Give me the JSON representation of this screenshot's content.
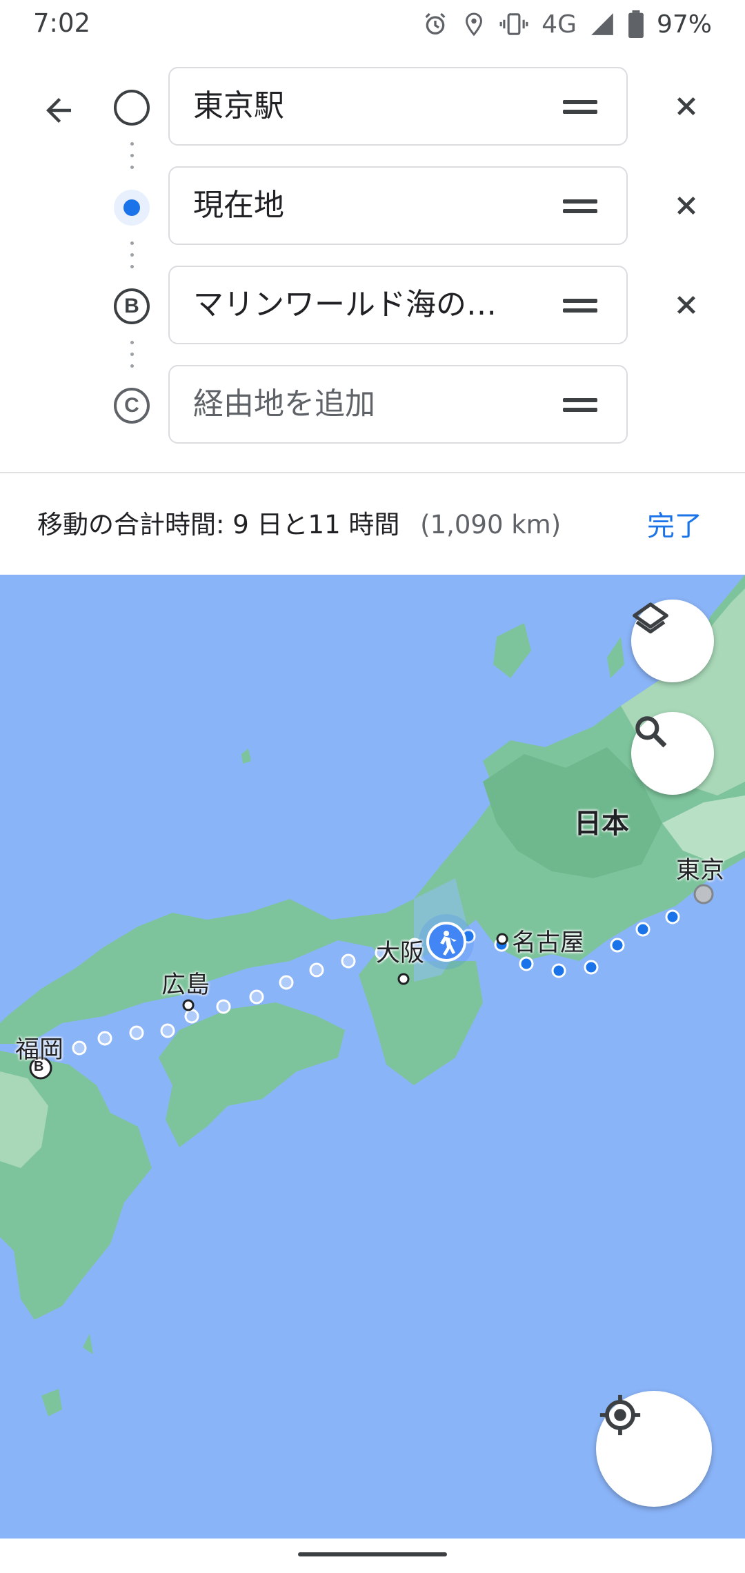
{
  "status_bar": {
    "time": "7:02",
    "network": "4G",
    "battery": "97%",
    "icons": [
      "alarm-icon",
      "location-icon",
      "vibrate-icon",
      "signal-icon",
      "battery-icon"
    ]
  },
  "directions": {
    "back_icon": "arrow-back-icon",
    "stops": [
      {
        "marker": "circle",
        "value": "東京駅",
        "placeholder": ""
      },
      {
        "marker": "current-location",
        "value": "現在地",
        "placeholder": ""
      },
      {
        "marker": "B",
        "value": "マリンワールド海の…",
        "placeholder": ""
      },
      {
        "marker": "C",
        "value": "",
        "placeholder": "経由地を追加"
      }
    ]
  },
  "summary": {
    "label": "移動の合計時間: 9 日と11 時間",
    "distance": "(1,090 km)",
    "done": "完了"
  },
  "map": {
    "labels": {
      "japan": "日本",
      "tokyo": "東京",
      "nagoya": "名古屋",
      "osaka": "大阪",
      "hiroshima": "広島",
      "fukuoka": "福岡"
    },
    "destination_marker": "B",
    "buttons": {
      "layers": "layers-icon",
      "search": "search-icon",
      "my_location": "my-location-icon"
    },
    "colors": {
      "water": "#8ab4f8",
      "land": "#7dc49c",
      "route": "#1a73e8"
    }
  }
}
